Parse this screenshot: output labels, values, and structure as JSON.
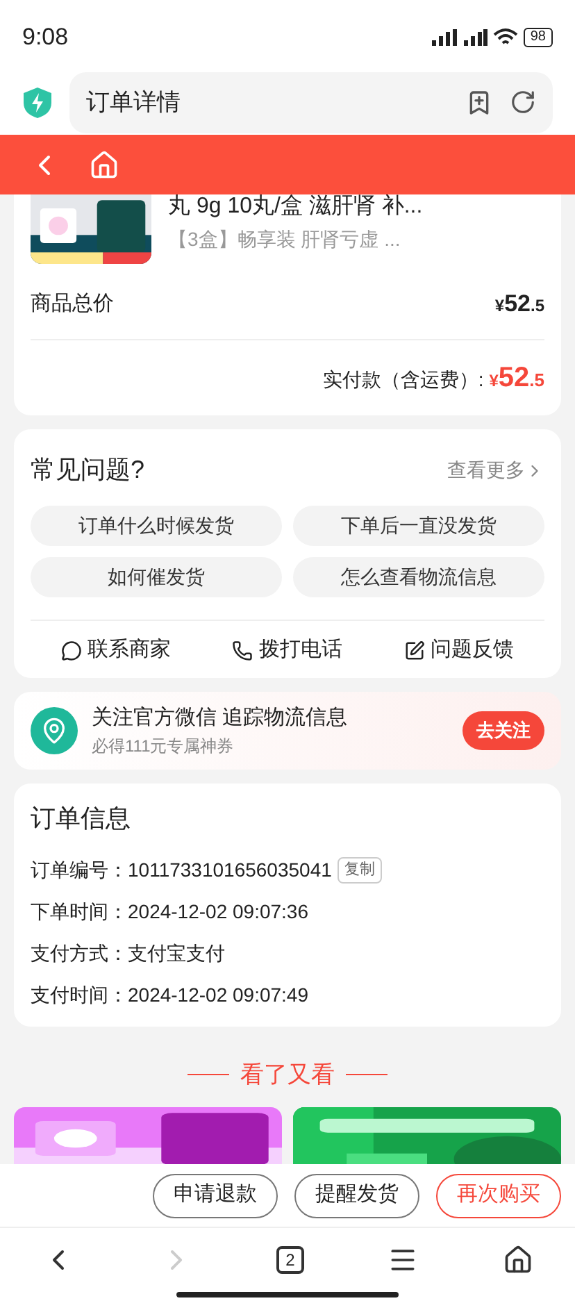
{
  "status_bar": {
    "time": "9:08",
    "battery": "98"
  },
  "browser_bar": {
    "address": "订单详情"
  },
  "product": {
    "title": "丸 9g 10丸/盒 滋肝肾 补...",
    "spec": "【3盒】畅享装 肝肾亏虚 ...",
    "total_label": "商品总价",
    "total_currency": "¥",
    "total_int": "52",
    "total_dec": ".5",
    "paid_label": "实付款（含运费）:",
    "paid_currency": "¥",
    "paid_int": "52",
    "paid_dec": ".5"
  },
  "faq": {
    "title": "常见问题?",
    "more": "查看更多",
    "questions": [
      "订单什么时候发货",
      "下单后一直没发货",
      "如何催发货",
      "怎么查看物流信息"
    ],
    "actions": [
      {
        "kind": "chat",
        "label": "联系商家"
      },
      {
        "kind": "phone",
        "label": "拨打电话"
      },
      {
        "kind": "feedback",
        "label": "问题反馈"
      }
    ]
  },
  "follow": {
    "title": "关注官方微信 追踪物流信息",
    "subtitle": "必得111元专属神券",
    "button": "去关注"
  },
  "order_info": {
    "title": "订单信息",
    "rows": [
      {
        "label": "订单编号：",
        "value": "1011733101656035041",
        "action": "复制"
      },
      {
        "label": "下单时间：",
        "value": "2024-12-02 09:07:36"
      },
      {
        "label": "支付方式：",
        "value": "支付宝支付"
      },
      {
        "label": "支付时间：",
        "value": "2024-12-02 09:07:49"
      }
    ]
  },
  "recommend": {
    "title": "看了又看"
  },
  "bottom_buttons": [
    {
      "label": "申请退款",
      "primary": false
    },
    {
      "label": "提醒发货",
      "primary": false
    },
    {
      "label": "再次购买",
      "primary": true
    }
  ],
  "browser_nav": {
    "tab_count": "2",
    "forward_disabled": true
  }
}
